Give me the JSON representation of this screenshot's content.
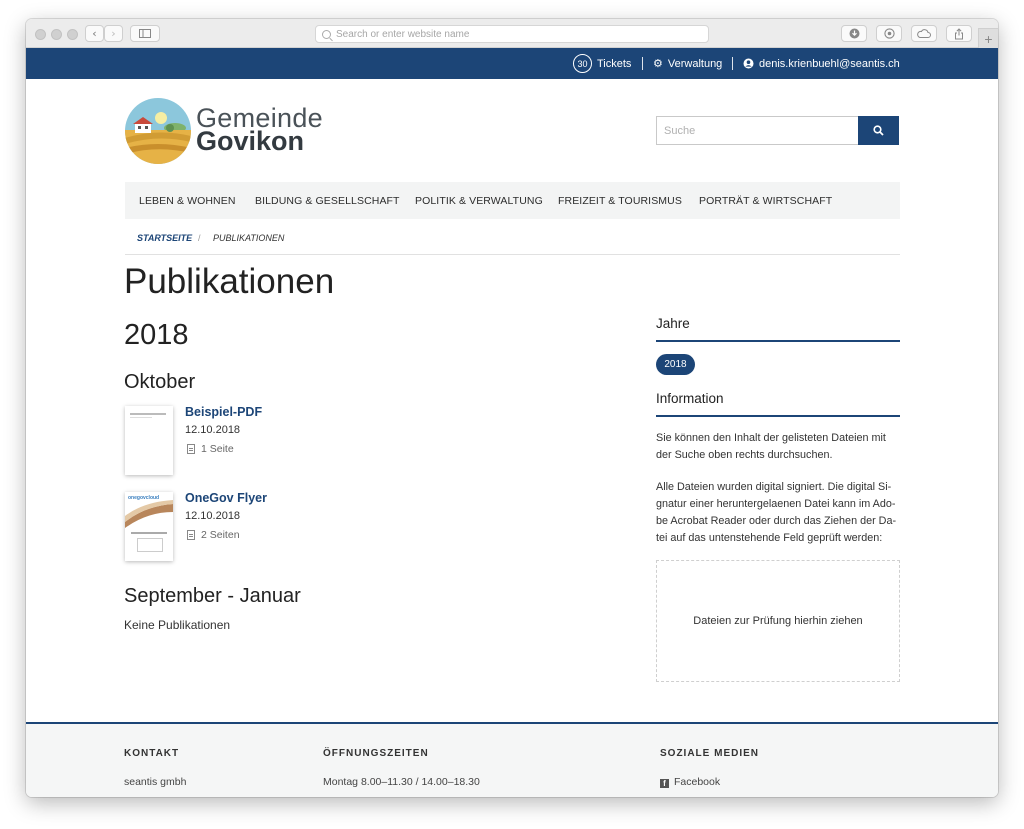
{
  "browser": {
    "url_placeholder": "Search or enter website name"
  },
  "topbar": {
    "ticket_count": "30",
    "tickets_label": "Tickets",
    "admin_label": "Verwaltung",
    "user_email": "denis.krienbuehl@seantis.ch"
  },
  "header": {
    "logo_line1": "Gemeinde",
    "logo_line2": "Govikon",
    "search_placeholder": "Suche"
  },
  "nav": {
    "items": [
      {
        "label": "LEBEN & WOHNEN"
      },
      {
        "label": "BILDUNG & GESELLSCHAFT"
      },
      {
        "label": "POLITIK & VERWALTUNG"
      },
      {
        "label": "FREIZEIT & TOURISMUS"
      },
      {
        "label": "PORTRÄT & WIRTSCHAFT"
      }
    ]
  },
  "breadcrumb": {
    "home": "STARTSEITE",
    "separator": "/",
    "current": "PUBLIKATIONEN"
  },
  "main": {
    "title": "Publikationen",
    "year": "2018",
    "month": "Oktober",
    "publications": [
      {
        "title": "Beispiel-PDF",
        "date": "12.10.2018",
        "pages": "1 Seite"
      },
      {
        "title": "OneGov Flyer",
        "date": "12.10.2018",
        "pages": "2 Seiten",
        "thumb_brand": "onegovcloud"
      }
    ],
    "range_heading": "September - Januar",
    "no_publications": "Keine Publikationen"
  },
  "sidebar": {
    "years_heading": "Jahre",
    "years": [
      "2018"
    ],
    "info_heading": "Information",
    "info_p1": "Sie können den Inhalt der gelisteten Dateien mit der Suche oben rechts durchsuchen.",
    "info_p2": "Alle Dateien wurden digital signiert. Die digital Si-gnatur einer heruntergelaenen Datei kann im Ado-be Acrobat Reader oder durch das Ziehen der Da-tei auf das untenstehende Feld geprüft werden:",
    "dropzone_label": "Dateien zur Prüfung hierhin ziehen"
  },
  "footer": {
    "contact_heading": "KONTAKT",
    "contact_line1": "seantis gmbh",
    "hours_heading": "ÖFFNUNGSZEITEN",
    "hours_line1": "Montag 8.00–11.30 / 14.00–18.30",
    "social_heading": "SOZIALE MEDIEN",
    "social_facebook": "Facebook"
  },
  "colors": {
    "brand_blue": "#1c4577",
    "nav_bg": "#f3f4f4",
    "footer_bg": "#f5f6f6"
  },
  "icons": [
    "search-icon",
    "gear-icon",
    "user-icon",
    "document-icon",
    "facebook-icon",
    "back-icon",
    "forward-icon",
    "sidebar-icon",
    "download-icon",
    "reader-icon",
    "cloud-icon",
    "share-icon",
    "new-tab-icon"
  ]
}
